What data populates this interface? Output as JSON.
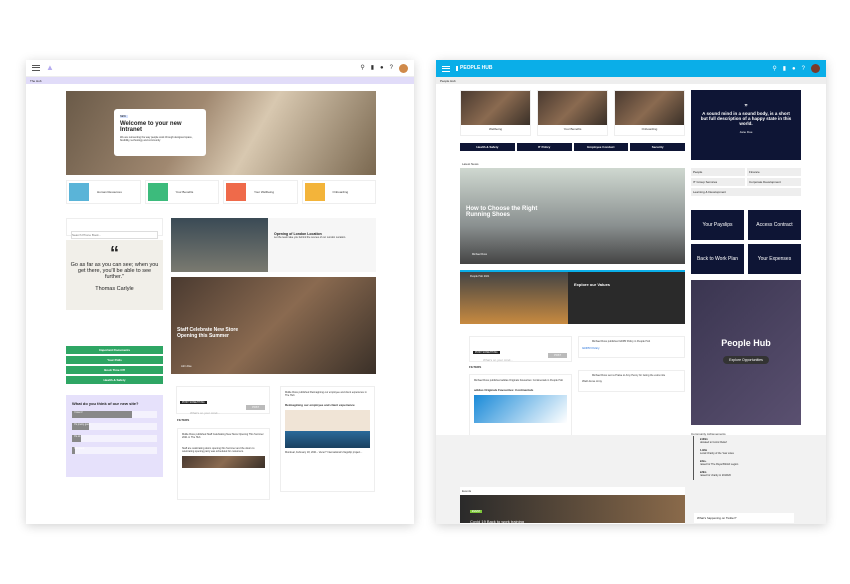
{
  "left": {
    "breadcrumb": "The Hub",
    "hero": {
      "tag": "NEW",
      "title": "Welcome to your new Intranet",
      "body": "We are reinventing the way people work through designed space, flexibility, technology and community"
    },
    "tiles": [
      {
        "label": "Human Resources"
      },
      {
        "label": "Your Benefits"
      },
      {
        "label": "Your Wellbeing"
      },
      {
        "label": "Onboarding"
      }
    ],
    "search_placeholder": "Search Phone Book...",
    "quote": {
      "text": "Go as far as you can see; when you get there, you'll be able to see further.\"",
      "author": "Thomas Carlyle"
    },
    "buttons": [
      "Important Documents",
      "Your Polls",
      "Book Time Off",
      "Health & Safety"
    ],
    "poll": {
      "question": "What do you think of our new site?",
      "options": [
        {
          "label": "I love it!",
          "pct": 70
        },
        {
          "label": "It's pretty good",
          "pct": 20
        },
        {
          "label": "It's ok",
          "pct": 10
        },
        {
          "label": "Not great",
          "pct": 0
        }
      ]
    },
    "video": {
      "title": "Opening of London Location",
      "desc": "Let the team take you behind the scenes of our London Location."
    },
    "story": {
      "title": "Staff Celebrate New Store Opening this Summer",
      "author": "John Doe",
      "role": "Marketing Manager"
    },
    "composer": {
      "badge": "POST SOMETHING",
      "placeholder": "What's on your mind...",
      "post": "POST"
    },
    "filters": "FILTERS",
    "feed": [
      {
        "header": "Mollie Ross published Staff Celebrating New Store Opening This Summer 2021 in The Hub",
        "time": "2 days ago",
        "body": "Staff are celebrating doors opening this Summer and the doors to celebrating opening party was scheduled for customers."
      },
      {
        "header": "Mollie Ross published Reimagining our employee and client experience in The Hub",
        "time": "2 days ago",
        "title": "Reimagining our employee and client experience",
        "body": "Montreal, February 18, 2021 - Vecer? International's flagship project..."
      }
    ]
  },
  "right": {
    "logo": "PEOPLE HUB",
    "breadcrumb": "People Hub",
    "tiles": [
      {
        "label": "Wellbeing"
      },
      {
        "label": "Your Benefits"
      },
      {
        "label": "Onboarding"
      }
    ],
    "buttons": [
      "Health & Safety",
      "IT Policy",
      "Employee Conduct",
      "Security"
    ],
    "quote": {
      "text": "A sound mind in a sound body, is a short but full description of a happy state in this world.",
      "author": "Jane Doe"
    },
    "links": [
      "People",
      "Finance",
      "IT Group Services",
      "Corporate Development",
      "Learning & Development"
    ],
    "actions": [
      "Your Payslips",
      "Access Contract",
      "Back to Work Plan",
      "Your Expenses"
    ],
    "news_label": "Latest News",
    "news": {
      "title": "How to Choose the Right Running Shoes",
      "author": "Michael Ross"
    },
    "video": {
      "channel": "People Hub 2021",
      "title": "Explore our Values"
    },
    "promo": {
      "title": "People Hub",
      "button": "Explore Opportunities"
    },
    "composer": {
      "badge": "POST SOMETHING",
      "placeholder": "What's on your mind...",
      "post": "POST"
    },
    "filters": "FILTERS",
    "feed": [
      {
        "header": "Michael Ross published GDPR Policy in People Hub",
        "time": "4 days ago",
        "link": "GDPR Policy"
      },
      {
        "header": "Michael Ross sent a Praise to Amy Penny for Going the extra mile",
        "time": "4 days ago",
        "body": "Well done Amy"
      },
      {
        "header": "Michael Ross published adidas Originals Favourites: Continentals in People Hub",
        "time": "5 days ago",
        "title": "adidas Originals Favourites: Continentals"
      }
    ],
    "achievements_title": "Community Achievements",
    "achievements": [
      {
        "value": "£130m",
        "desc": "donated to Comic Relief"
      },
      {
        "value": "1.92m",
        "desc": "Local Charity of the Year votes"
      },
      {
        "value": "£3m+",
        "desc": "raised for The Royal British Legion"
      },
      {
        "value": "£29m",
        "desc": "raised for charity in 2019/20"
      }
    ],
    "events_label": "Events",
    "event": {
      "tag": "EVENT",
      "title": "Covid 19 Back to work training"
    },
    "twitter": "What's happening on Twitter?"
  }
}
